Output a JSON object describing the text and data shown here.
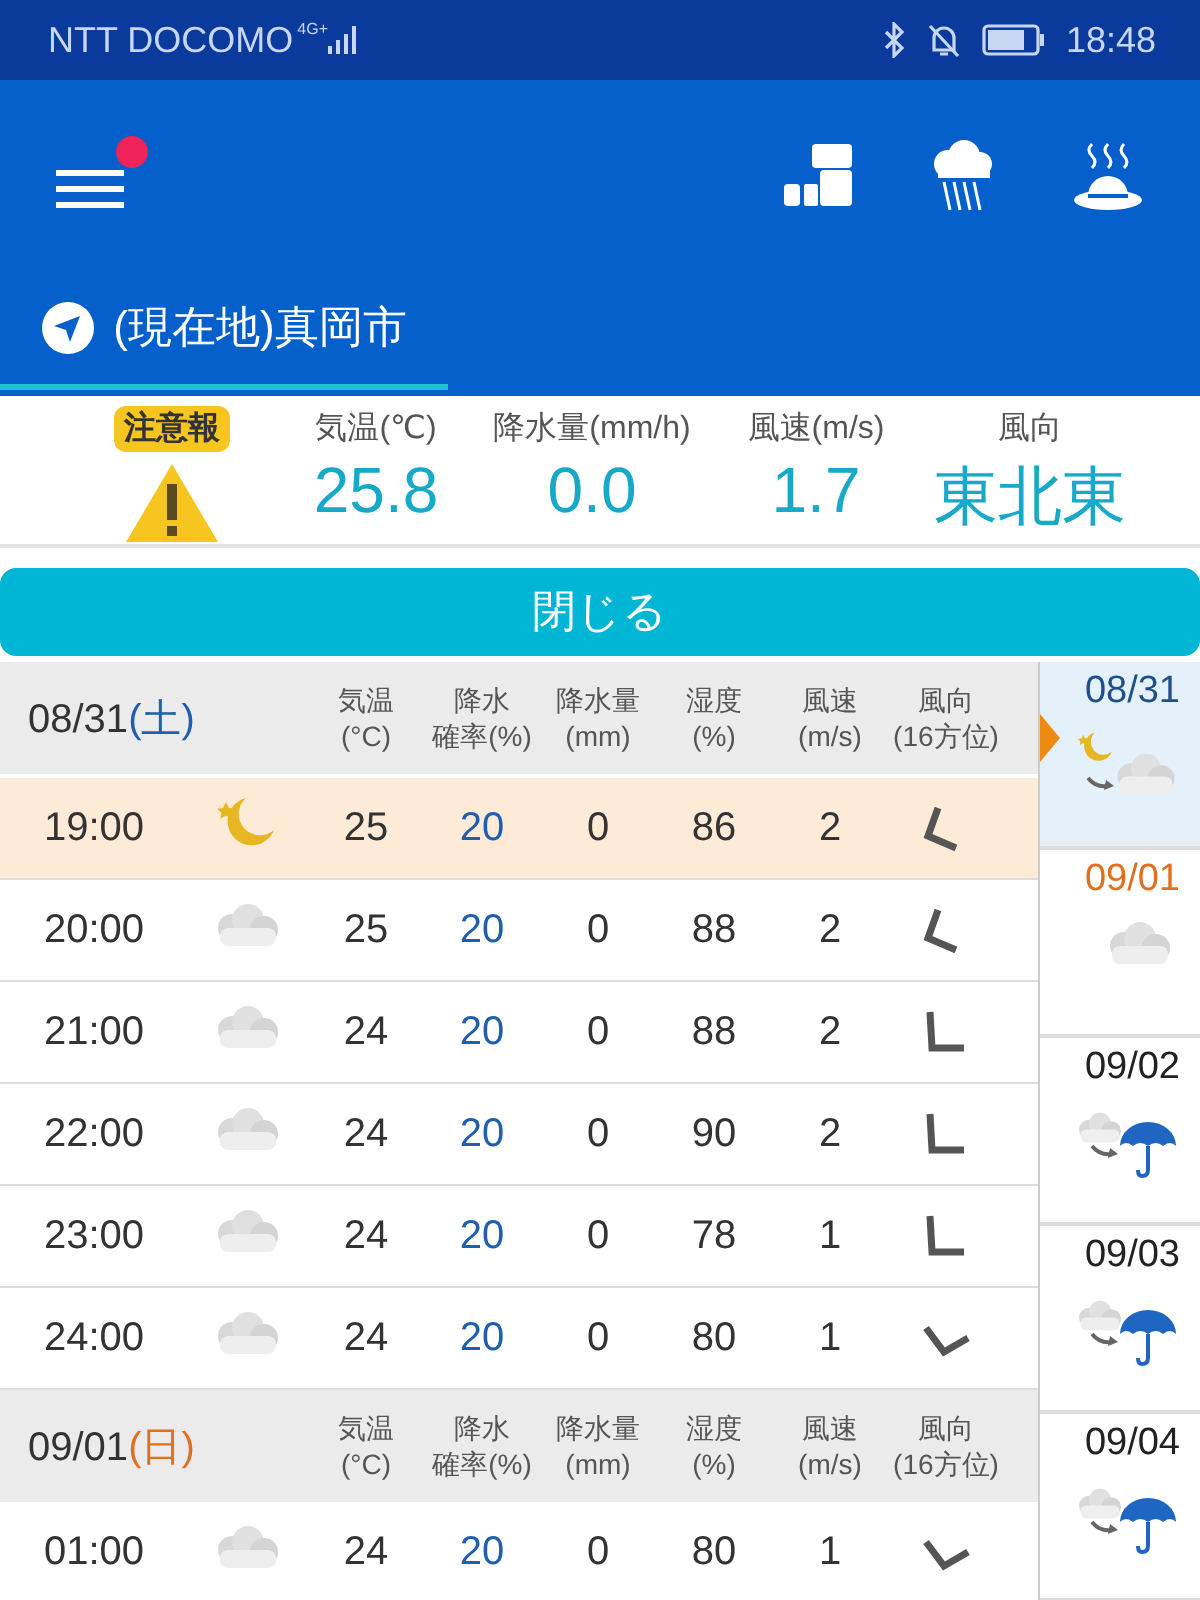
{
  "status_bar": {
    "carrier": "NTT DOCOMO",
    "network": "4G+",
    "time": "18:48"
  },
  "app_bar": {
    "menu_notification": true
  },
  "location_tab": {
    "label": "(現在地)真岡市",
    "selected": true
  },
  "current": {
    "alert": "注意報",
    "measures": [
      {
        "label": "気温(℃)",
        "value": "25.8"
      },
      {
        "label": "降水量(mm/h)",
        "value": "0.0"
      },
      {
        "label": "風速(m/s)",
        "value": "1.7"
      },
      {
        "label": "風向",
        "value": "東北東"
      }
    ]
  },
  "close_button": "閉じる",
  "day_groups": [
    {
      "date": "08/31",
      "weekday": "(土)",
      "color": "#1f5fb0",
      "columns": [
        {
          "top": "気温",
          "bottom": "(°C)"
        },
        {
          "top": "降水",
          "bottom": "確率(%)"
        },
        {
          "top": "降水量",
          "bottom": "(mm)"
        },
        {
          "top": "湿度",
          "bottom": "(%)"
        },
        {
          "top": "風速",
          "bottom": "(m/s)"
        },
        {
          "top": "風向",
          "bottom": "(16方位)"
        }
      ],
      "rows": [
        {
          "time": "19:00",
          "weather_icon": {
            "kind": "moon"
          },
          "temp": "25",
          "prob": "20",
          "precip": "0",
          "humidity": "86",
          "wind": "2",
          "wind_icon": {
            "kind": "ne"
          },
          "selected": true
        },
        {
          "time": "20:00",
          "weather_icon": {
            "kind": "cloudy"
          },
          "temp": "25",
          "prob": "20",
          "precip": "0",
          "humidity": "88",
          "wind": "2",
          "wind_icon": {
            "kind": "ne"
          },
          "selected": false
        },
        {
          "time": "21:00",
          "weather_icon": {
            "kind": "cloudy"
          },
          "temp": "24",
          "prob": "20",
          "precip": "0",
          "humidity": "88",
          "wind": "2",
          "wind_icon": {
            "kind": "e"
          },
          "selected": false
        },
        {
          "time": "22:00",
          "weather_icon": {
            "kind": "cloudy"
          },
          "temp": "24",
          "prob": "20",
          "precip": "0",
          "humidity": "90",
          "wind": "2",
          "wind_icon": {
            "kind": "e"
          },
          "selected": false
        },
        {
          "time": "23:00",
          "weather_icon": {
            "kind": "cloudy"
          },
          "temp": "24",
          "prob": "20",
          "precip": "0",
          "humidity": "78",
          "wind": "1",
          "wind_icon": {
            "kind": "e"
          },
          "selected": false
        },
        {
          "time": "24:00",
          "weather_icon": {
            "kind": "cloudy"
          },
          "temp": "24",
          "prob": "20",
          "precip": "0",
          "humidity": "80",
          "wind": "1",
          "wind_icon": {
            "kind": "se"
          },
          "selected": false
        }
      ]
    },
    {
      "date": "09/01",
      "weekday": "(日)",
      "color": "#e07020",
      "columns": [
        {
          "top": "気温",
          "bottom": "(°C)"
        },
        {
          "top": "降水",
          "bottom": "確率(%)"
        },
        {
          "top": "降水量",
          "bottom": "(mm)"
        },
        {
          "top": "湿度",
          "bottom": "(%)"
        },
        {
          "top": "風速",
          "bottom": "(m/s)"
        },
        {
          "top": "風向",
          "bottom": "(16方位)"
        }
      ],
      "rows": [
        {
          "time": "01:00",
          "weather_icon": {
            "kind": "cloudy"
          },
          "temp": "24",
          "prob": "20",
          "precip": "0",
          "humidity": "80",
          "wind": "1",
          "wind_icon": {
            "kind": "se"
          },
          "selected": false
        }
      ]
    }
  ],
  "days": [
    {
      "date": "08/31",
      "color": "#1f4f8a",
      "weather_icon": {
        "kind": "night-to-cloudy"
      },
      "selected": true
    },
    {
      "date": "09/01",
      "color": "#e07020",
      "weather_icon": {
        "kind": "cloudy"
      },
      "selected": false
    },
    {
      "date": "09/02",
      "color": "#222222",
      "weather_icon": {
        "kind": "cloudy-to-rain"
      },
      "selected": false
    },
    {
      "date": "09/03",
      "color": "#222222",
      "weather_icon": {
        "kind": "cloudy-to-rain"
      },
      "selected": false
    },
    {
      "date": "09/04",
      "color": "#222222",
      "weather_icon": {
        "kind": "cloudy-to-rain"
      },
      "selected": false
    }
  ]
}
